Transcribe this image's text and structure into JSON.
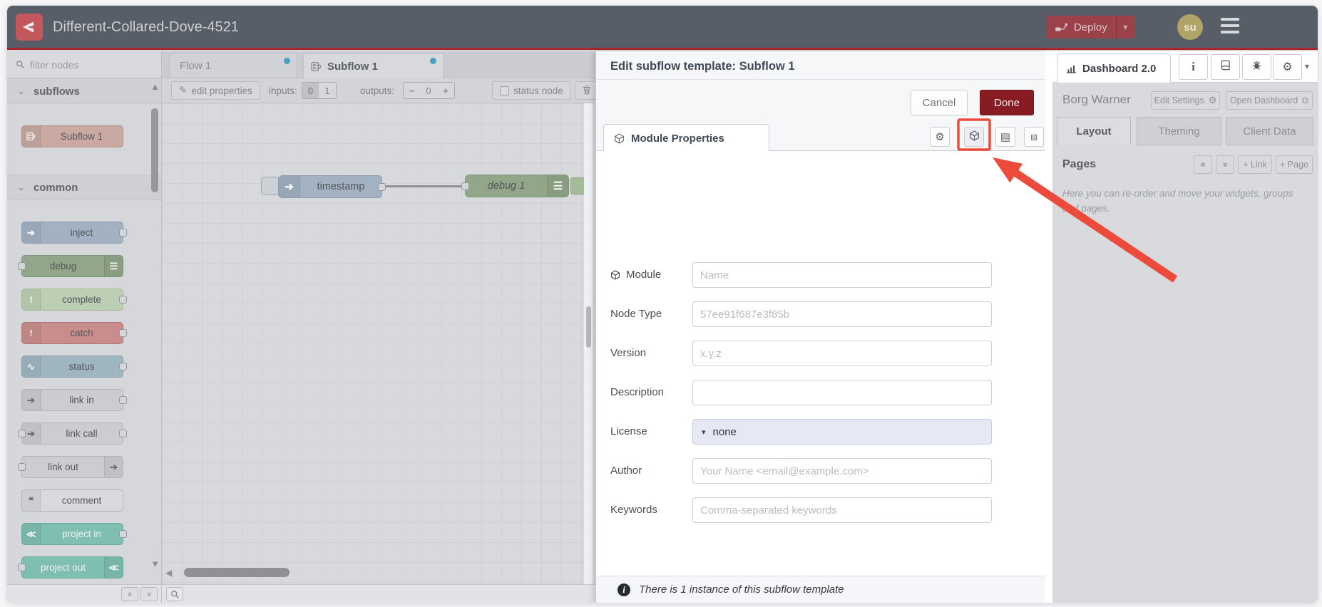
{
  "window": {
    "title": "Different-Collared-Dove-4521"
  },
  "colors": {
    "header_bg": "#585e67",
    "accent_red": "#a8272e",
    "deploy_bg": "#9a4149",
    "done_bg": "#871c23",
    "annotation_red": "#ec4b3c",
    "unsaved_dot": "#4e9fbe",
    "license_field_bg": "#e6e9f4"
  },
  "header": {
    "deploy_label": "Deploy",
    "avatar_initials": "su"
  },
  "palette": {
    "filter_placeholder": "filter nodes",
    "categories": [
      {
        "label": "subflows",
        "nodes": [
          {
            "name": "subflow-1",
            "label": "Subflow 1",
            "icon": "subflow",
            "icon_side": "left",
            "ports": "none",
            "color": "#c9a9a2",
            "border": "#b08f88"
          }
        ]
      },
      {
        "label": "common",
        "nodes": [
          {
            "name": "inject",
            "label": "inject",
            "icon": "inject",
            "icon_side": "left",
            "ports": "out",
            "color": "#a2b2c3",
            "border": "#8d9dae"
          },
          {
            "name": "debug",
            "label": "debug",
            "icon": "debug",
            "icon_side": "right",
            "ports": "in",
            "color": "#92a78a",
            "border": "#7e9476"
          },
          {
            "name": "complete",
            "label": "complete",
            "icon": "complete",
            "icon_side": "left",
            "ports": "out",
            "color": "#bccfb2",
            "border": "#a3b899"
          },
          {
            "name": "catch",
            "label": "catch",
            "icon": "catch",
            "icon_side": "left",
            "ports": "out",
            "color": "#c98e8c",
            "border": "#b07674"
          },
          {
            "name": "status",
            "label": "status",
            "icon": "status",
            "icon_side": "left",
            "ports": "out",
            "color": "#9fb6c1",
            "border": "#88a0ac"
          },
          {
            "name": "link-in",
            "label": "link in",
            "icon": "link",
            "icon_side": "left",
            "ports": "out",
            "color": "#cccdd1",
            "border": "#b3b4b9"
          },
          {
            "name": "link-call",
            "label": "link call",
            "icon": "link",
            "icon_side": "left",
            "ports": "both",
            "color": "#cccdd1",
            "border": "#b3b4b9"
          },
          {
            "name": "link-out",
            "label": "link out",
            "icon": "link",
            "icon_side": "right",
            "ports": "in",
            "color": "#cccdd1",
            "border": "#b3b4b9"
          },
          {
            "name": "comment",
            "label": "comment",
            "icon": "comment",
            "icon_side": "left",
            "ports": "none",
            "color": "#d9dadd",
            "border": "#b3b4b9"
          },
          {
            "name": "project-in",
            "label": "project in",
            "icon": "project",
            "icon_side": "left",
            "ports": "out",
            "color": "#7fbfb1",
            "border": "#69a99b",
            "light_label": true
          },
          {
            "name": "project-out",
            "label": "project out",
            "icon": "project",
            "icon_side": "right",
            "ports": "in",
            "color": "#7fbfb1",
            "border": "#69a99b",
            "light_label": true
          }
        ]
      }
    ]
  },
  "workspace": {
    "tabs": [
      {
        "label": "Flow 1"
      },
      {
        "label": "Subflow 1"
      }
    ],
    "toolbar": {
      "edit_properties": "edit properties",
      "inputs_label": "inputs:",
      "input_options": [
        "0",
        "1"
      ],
      "outputs_label": "outputs:",
      "outputs_controls": [
        "−",
        "0",
        "+"
      ],
      "status_node": "status node"
    },
    "nodes": {
      "inject_label": "timestamp",
      "debug_label": "debug 1"
    }
  },
  "tray": {
    "title": "Edit subflow template: Subflow 1",
    "cancel": "Cancel",
    "done": "Done",
    "tab": "Module Properties",
    "fields": [
      {
        "label": "Module",
        "placeholder": "Name"
      },
      {
        "label": "Node Type",
        "placeholder": "57ee91f687e3f85b"
      },
      {
        "label": "Version",
        "placeholder": "x.y.z"
      },
      {
        "label": "Description",
        "placeholder": ""
      },
      {
        "label": "License",
        "value": "none"
      },
      {
        "label": "Author",
        "placeholder": "Your Name <email@example.com>"
      },
      {
        "label": "Keywords",
        "placeholder": "Comma-separated keywords"
      }
    ],
    "footer": "There is 1 instance of this subflow template"
  },
  "sidebar": {
    "tab": "Dashboard 2.0",
    "instance_name": "Borg Warner",
    "edit_settings": "Edit Settings",
    "open_dashboard": "Open Dashboard",
    "tabs": [
      "Layout",
      "Theming",
      "Client Data"
    ],
    "pages_title": "Pages",
    "add_link": "+ Link",
    "add_page": "+ Page",
    "help_text": "Here you can re-order and move your widgets, groups and pages."
  }
}
